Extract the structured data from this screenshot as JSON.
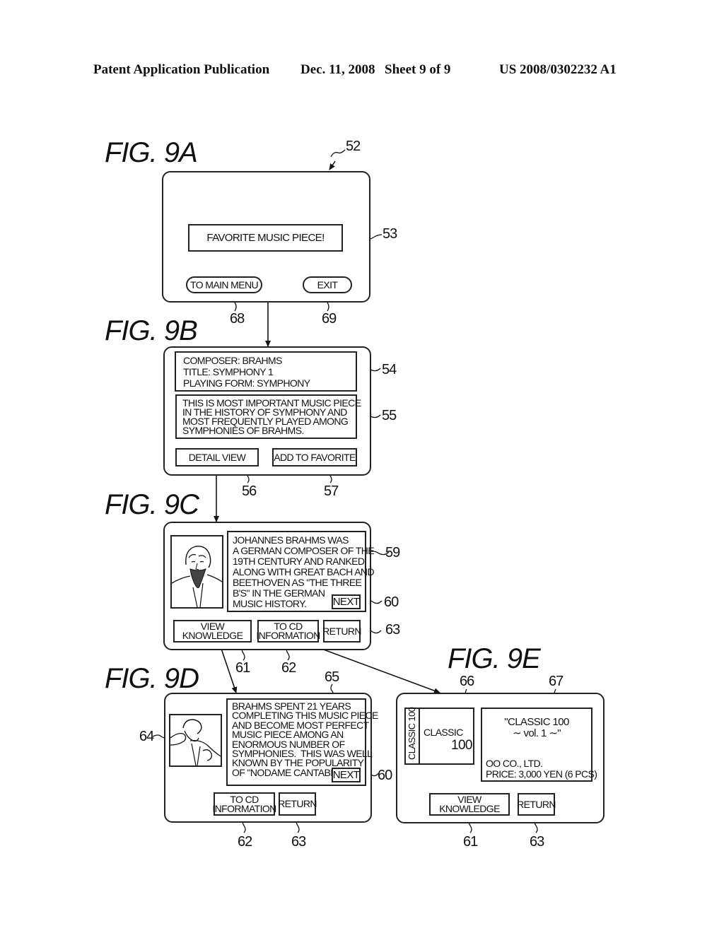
{
  "header": {
    "publication": "Patent Application Publication",
    "date": "Dec. 11, 2008",
    "sheet": "Sheet 9 of 9",
    "patent_number": "US 2008/0302232 A1"
  },
  "figures": {
    "fig9a": {
      "label": "FIG.  9A",
      "ref_screen": "52",
      "message": "FAVORITE MUSIC PIECE!",
      "ref_message": "53",
      "buttons": [
        {
          "label": "TO MAIN MENU",
          "ref": "68"
        },
        {
          "label": "EXIT",
          "ref": "69"
        }
      ]
    },
    "fig9b": {
      "label": "FIG.  9B",
      "info_lines": [
        "COMPOSER: BRAHMS",
        "TITLE: SYMPHONY 1",
        "PLAYING FORM: SYMPHONY"
      ],
      "ref_info": "54",
      "description_lines": [
        "THIS IS MOST IMPORTANT MUSIC PIECE",
        "IN THE HISTORY OF SYMPHONY AND",
        "MOST FREQUENTLY PLAYED AMONG",
        "SYMPHONIES OF BRAHMS."
      ],
      "ref_description": "55",
      "buttons": [
        {
          "label": "DETAIL VIEW",
          "ref": "56"
        },
        {
          "label": "ADD TO FAVORITE",
          "ref": "57"
        }
      ]
    },
    "fig9c": {
      "label": "FIG.  9C",
      "text_lines": [
        "JOHANNES BRAHMS WAS",
        "A GERMAN COMPOSER OF THE",
        "19TH CENTURY AND RANKED",
        "ALONG WITH GREAT BACH AND",
        "BEETHOVEN AS \"THE THREE",
        "B'S\" IN THE GERMAN",
        "MUSIC HISTORY."
      ],
      "ref_text": "59",
      "next_label": "NEXT",
      "ref_next": "60",
      "buttons": [
        {
          "label": "VIEW KNOWLEDGE",
          "ref": "61"
        },
        {
          "label_lines": [
            "TO CD",
            "INFORMATION"
          ],
          "ref": "62"
        },
        {
          "label": "RETURN",
          "ref": "63"
        }
      ]
    },
    "fig9d": {
      "label": "FIG.  9D",
      "ref_image": "64",
      "ref_text": "65",
      "text_lines": [
        "BRAHMS SPENT 21 YEARS",
        "COMPLETING THIS MUSIC PIECE",
        "AND BECOME MOST PERFECT",
        "MUSIC PIECE AMONG AN",
        "ENORMOUS NUMBER OF",
        "SYMPHONIES.  THIS WAS WELL",
        "KNOWN BY THE POPULARITY",
        "OF \"NODAME CANTABILE\"."
      ],
      "next_label": "NEXT",
      "ref_next": "60",
      "buttons": [
        {
          "label_lines": [
            "TO CD",
            "INFORMATION"
          ],
          "ref": "62"
        },
        {
          "label": "RETURN",
          "ref": "63"
        }
      ]
    },
    "fig9e": {
      "label": "FIG.  9E",
      "ref_cover": "66",
      "ref_details": "67",
      "cover_spine": "CLASSIC 100",
      "cover_title_1": "CLASSIC",
      "cover_title_2": "100",
      "album_title_lines": [
        "\"CLASSIC 100",
        "∼ vol. 1 ∼\""
      ],
      "company": "OO CO., LTD.",
      "price": "PRICE: 3,000 YEN (6 PCS)",
      "buttons": [
        {
          "label": "VIEW KNOWLEDGE",
          "ref": "61"
        },
        {
          "label": "RETURN",
          "ref": "63"
        }
      ]
    }
  }
}
